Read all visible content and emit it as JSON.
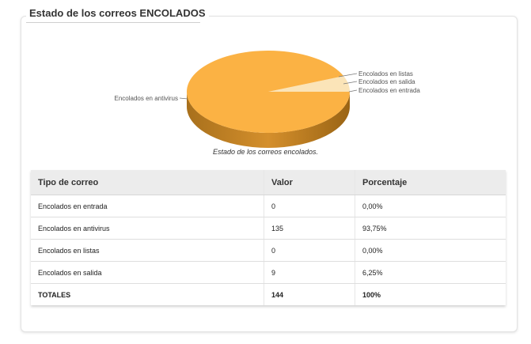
{
  "panel": {
    "title": "Estado de los correos ENCOLADOS"
  },
  "chart_data": {
    "type": "pie",
    "title": "",
    "caption": "Estado de los correos encolados.",
    "categories": [
      "Encolados en entrada",
      "Encolados en antivirus",
      "Encolados en listas",
      "Encolados en salida"
    ],
    "values": [
      0,
      135,
      0,
      9
    ],
    "colors": [
      "#fce3b8",
      "#fbb244",
      "#fce3b8",
      "#fbe4b8"
    ],
    "labels": [
      {
        "text": "Encolados en listas"
      },
      {
        "text": "Encolados en salida"
      },
      {
        "text": "Encolados en entrada"
      },
      {
        "text": "Encolados en antivirus"
      }
    ]
  },
  "table": {
    "headers": [
      "Tipo de correo",
      "Valor",
      "Porcentaje"
    ],
    "rows": [
      [
        "Encolados en entrada",
        "0",
        "0,00%"
      ],
      [
        "Encolados en antivirus",
        "135",
        "93,75%"
      ],
      [
        "Encolados en listas",
        "0",
        "0,00%"
      ],
      [
        "Encolados en salida",
        "9",
        "6,25%"
      ]
    ],
    "total": [
      "TOTALES",
      "144",
      "100%"
    ]
  }
}
